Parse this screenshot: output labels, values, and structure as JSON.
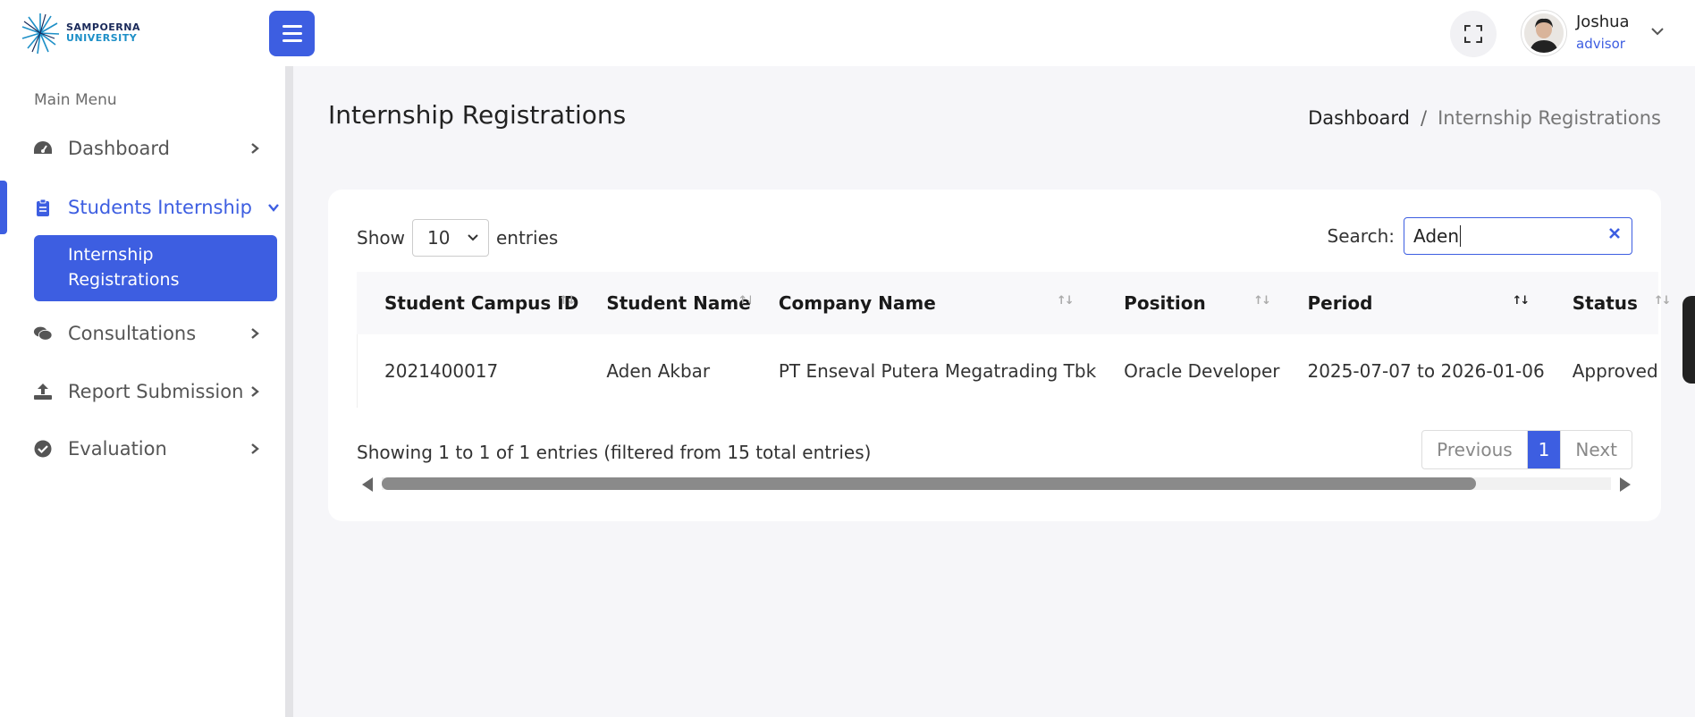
{
  "brand": {
    "line1": "SAMPOERNA",
    "line2": "UNIVERSITY"
  },
  "header": {
    "user_name": "Joshua",
    "user_role": "advisor"
  },
  "sidebar": {
    "section_label": "Main Menu",
    "items": [
      {
        "label": "Dashboard"
      },
      {
        "label": "Students Internship"
      },
      {
        "label": "Consultations"
      },
      {
        "label": "Report Submission"
      },
      {
        "label": "Evaluation"
      }
    ],
    "submenu": {
      "label": "Internship Registrations"
    }
  },
  "page": {
    "title": "Internship Registrations",
    "breadcrumb": {
      "home": "Dashboard",
      "separator": "/",
      "current": "Internship Registrations"
    }
  },
  "table_controls": {
    "show_label": "Show",
    "entries_value": "10",
    "entries_label": "entries",
    "search_label": "Search:",
    "search_value": "Aden"
  },
  "table": {
    "columns": [
      "Student Campus ID",
      "Student Name",
      "Company Name",
      "Position",
      "Period",
      "Status"
    ],
    "rows": [
      [
        "2021400017",
        "Aden Akbar",
        "PT Enseval Putera Megatrading Tbk",
        "Oracle Developer",
        "2025-07-07 to 2026-01-06",
        "Approved"
      ]
    ]
  },
  "footer": {
    "info": "Showing 1 to 1 of 1 entries (filtered from 15 total entries)",
    "previous": "Previous",
    "page": "1",
    "next": "Next"
  },
  "colors": {
    "accent": "#3d5ee1",
    "background": "#f6f6f9"
  }
}
